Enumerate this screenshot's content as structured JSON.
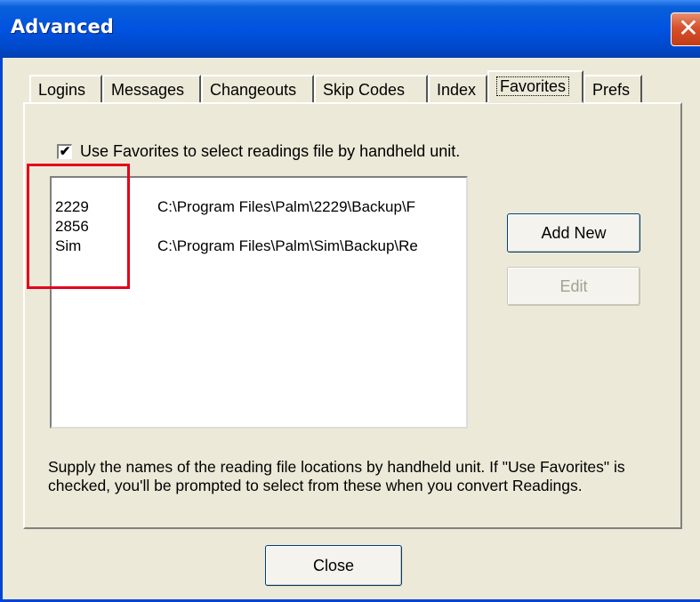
{
  "window": {
    "title": "Advanced",
    "close_glyph": "✕"
  },
  "tabs": [
    {
      "label": "Logins",
      "active": false
    },
    {
      "label": "Messages",
      "active": false
    },
    {
      "label": "Changeouts",
      "active": false
    },
    {
      "label": "Skip Codes",
      "active": false
    },
    {
      "label": "Index",
      "active": false
    },
    {
      "label": "Favorites",
      "active": true
    },
    {
      "label": "Prefs",
      "active": false
    }
  ],
  "favorites": {
    "use_favorites": {
      "checked": true,
      "check_glyph": "✔",
      "label": "Use Favorites to select readings file by handheld unit."
    },
    "list": [
      {
        "unit": "2229",
        "path": "C:\\Program Files\\Palm\\2229\\Backup\\F"
      },
      {
        "unit": "2856",
        "path": ""
      },
      {
        "unit": "Sim",
        "path": "C:\\Program Files\\Palm\\Sim\\Backup\\Re"
      }
    ],
    "add_new_label": "Add New",
    "edit_label": "Edit",
    "help_text": "Supply the names of the reading file locations by handheld unit.  If \"Use Favorites\" is checked, you'll be prompted to select from these when you convert Readings."
  },
  "footer": {
    "close_label": "Close"
  },
  "annotation": {
    "highlight_color": "#e3001b"
  }
}
